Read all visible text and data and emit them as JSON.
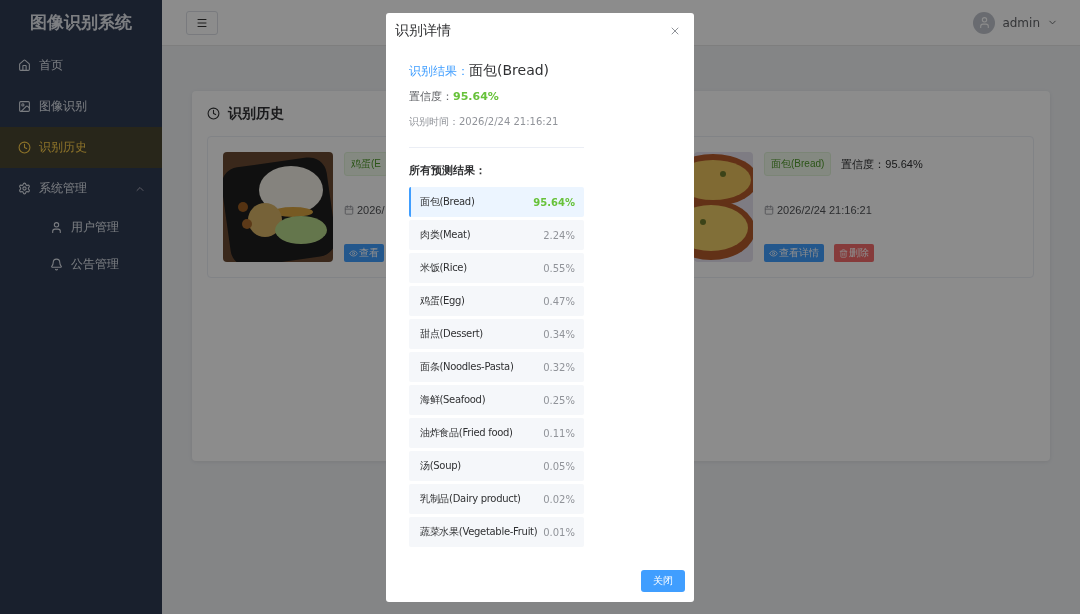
{
  "app": {
    "title": "图像识别系统"
  },
  "sidebar": {
    "items": [
      {
        "label": "首页",
        "selected": false
      },
      {
        "label": "图像识别",
        "selected": false
      },
      {
        "label": "识别历史",
        "selected": true
      },
      {
        "label": "系统管理",
        "selected": false,
        "expanded": true,
        "children": [
          {
            "label": "用户管理",
            "selected": false
          },
          {
            "label": "公告管理",
            "selected": false
          }
        ]
      }
    ]
  },
  "header": {
    "user": "admin"
  },
  "panel": {
    "title": "识别历史",
    "records": [
      {
        "tag": "鸡蛋(E",
        "date": "2026/",
        "actions": [
          {
            "label": "查看",
            "kind": "view"
          }
        ]
      },
      {
        "tag": "面包(Bread)",
        "confidence": "置信度：95.64%",
        "date": "2026/2/24 21:16:21",
        "actions": [
          {
            "label": "查看详情",
            "kind": "view"
          },
          {
            "label": "删除",
            "kind": "delete"
          }
        ]
      }
    ]
  },
  "dialog": {
    "title": "识别详情",
    "result_label": "识别结果：",
    "result": "面包(Bread)",
    "confidence_label": "置信度：",
    "confidence": "95.64%",
    "time": "识别时间：2026/2/24 21:16:21",
    "list_title": "所有预测结果：",
    "predictions": [
      {
        "name": "面包(Bread)",
        "value": "95.64%",
        "selected": true
      },
      {
        "name": "肉类(Meat)",
        "value": "2.24%",
        "selected": false
      },
      {
        "name": "米饭(Rice)",
        "value": "0.55%",
        "selected": false
      },
      {
        "name": "鸡蛋(Egg)",
        "value": "0.47%",
        "selected": false
      },
      {
        "name": "甜点(Dessert)",
        "value": "0.34%",
        "selected": false
      },
      {
        "name": "面条(Noodles-Pasta)",
        "value": "0.32%",
        "selected": false
      },
      {
        "name": "海鲜(Seafood)",
        "value": "0.25%",
        "selected": false
      },
      {
        "name": "油炸食品(Fried food)",
        "value": "0.11%",
        "selected": false
      },
      {
        "name": "汤(Soup)",
        "value": "0.05%",
        "selected": false
      },
      {
        "name": "乳制品(Dairy product)",
        "value": "0.02%",
        "selected": false
      },
      {
        "name": "蔬菜水果(Vegetable-Fruit)",
        "value": "0.01%",
        "selected": false
      }
    ],
    "close_button": "关闭"
  }
}
